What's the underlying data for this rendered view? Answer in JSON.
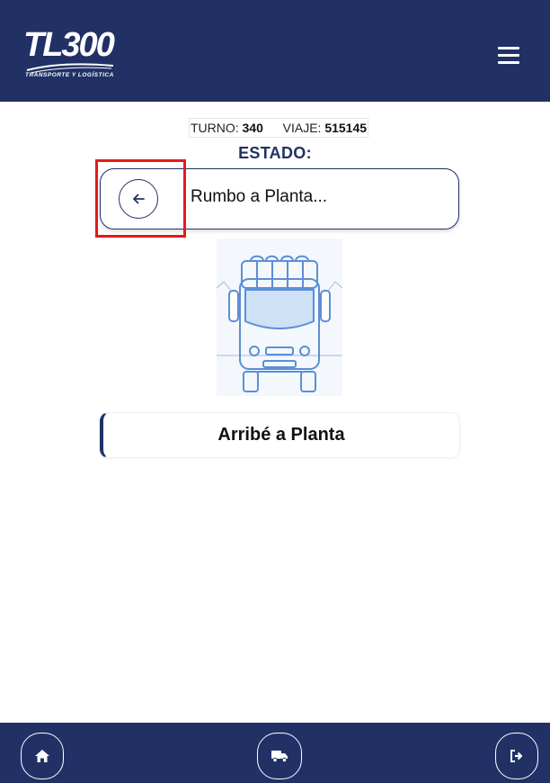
{
  "header": {
    "logo_text": "TL300",
    "logo_tagline": "TRANSPORTE Y LOGÍSTICA",
    "menu_icon": "hamburger-icon"
  },
  "trip_info": {
    "turno_label": "TURNO:",
    "turno_value": "340",
    "viaje_label": "VIAJE:",
    "viaje_value": "515145"
  },
  "estado": {
    "title": "ESTADO:",
    "back_icon": "arrow-left-icon",
    "status_text": "Rumbo a Planta..."
  },
  "illustration": {
    "icon": "truck-front-icon"
  },
  "action": {
    "label": "Arribé a Planta"
  },
  "footer": {
    "home_icon": "home-icon",
    "truck_icon": "truck-icon",
    "logout_icon": "logout-icon"
  },
  "colors": {
    "brand_navy": "#213165",
    "highlight_red": "#e5191b",
    "illustration_blue": "#5b8fd6",
    "illustration_fill": "#cfe1f7"
  }
}
